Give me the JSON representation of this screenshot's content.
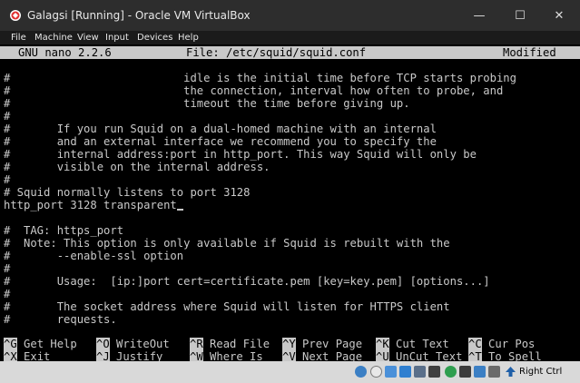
{
  "window": {
    "title": "Galagsi [Running] - Oracle VM VirtualBox",
    "minimize_glyph": "—",
    "maximize_glyph": "☐",
    "close_glyph": "✕"
  },
  "menu": [
    "File",
    "Machine",
    "View",
    "Input",
    "Devices",
    "Help"
  ],
  "nano": {
    "version": "GNU nano 2.2.6",
    "file": "File: /etc/squid/squid.conf",
    "state": "Modified",
    "lines": [
      "#                          idle is the initial time before TCP starts probing",
      "#                          the connection, interval how often to probe, and",
      "#                          timeout the time before giving up.",
      "#",
      "#       If you run Squid on a dual-homed machine with an internal",
      "#       and an external interface we recommend you to specify the",
      "#       internal address:port in http_port. This way Squid will only be",
      "#       visible on the internal address.",
      "#",
      "# Squid normally listens to port 3128",
      "http_port 3128 transparent",
      "",
      "#  TAG: https_port",
      "#  Note: This option is only available if Squid is rebuilt with the",
      "#       --enable-ssl option",
      "#",
      "#       Usage:  [ip:]port cert=certificate.pem [key=key.pem] [options...]",
      "#",
      "#       The socket address where Squid will listen for HTTPS client",
      "#       requests."
    ],
    "shortcuts_row1": [
      {
        "key": "^G",
        "label": "Get Help"
      },
      {
        "key": "^O",
        "label": "WriteOut"
      },
      {
        "key": "^R",
        "label": "Read File"
      },
      {
        "key": "^Y",
        "label": "Prev Page"
      },
      {
        "key": "^K",
        "label": "Cut Text"
      },
      {
        "key": "^C",
        "label": "Cur Pos"
      }
    ],
    "shortcuts_row2": [
      {
        "key": "^X",
        "label": "Exit"
      },
      {
        "key": "^J",
        "label": "Justify"
      },
      {
        "key": "^W",
        "label": "Where Is"
      },
      {
        "key": "^V",
        "label": "Next Page"
      },
      {
        "key": "^U",
        "label": "UnCut Text"
      },
      {
        "key": "^T",
        "label": "To Spell"
      }
    ]
  },
  "statusbar": {
    "host_key": "Right Ctrl",
    "icons": [
      "hard-disk-icon",
      "optical-drive-icon",
      "audio-icon",
      "network-icon",
      "usb-icon",
      "shared-folders-icon",
      "display-icon",
      "video-capture-icon",
      "mouse-integration-icon",
      "keyboard-capture-icon"
    ],
    "colors": {
      "titlebar": "#2d2d2d",
      "terminal_bg": "#000000",
      "terminal_fg": "#c9c9c9",
      "accent": "#3b7fc4"
    }
  }
}
